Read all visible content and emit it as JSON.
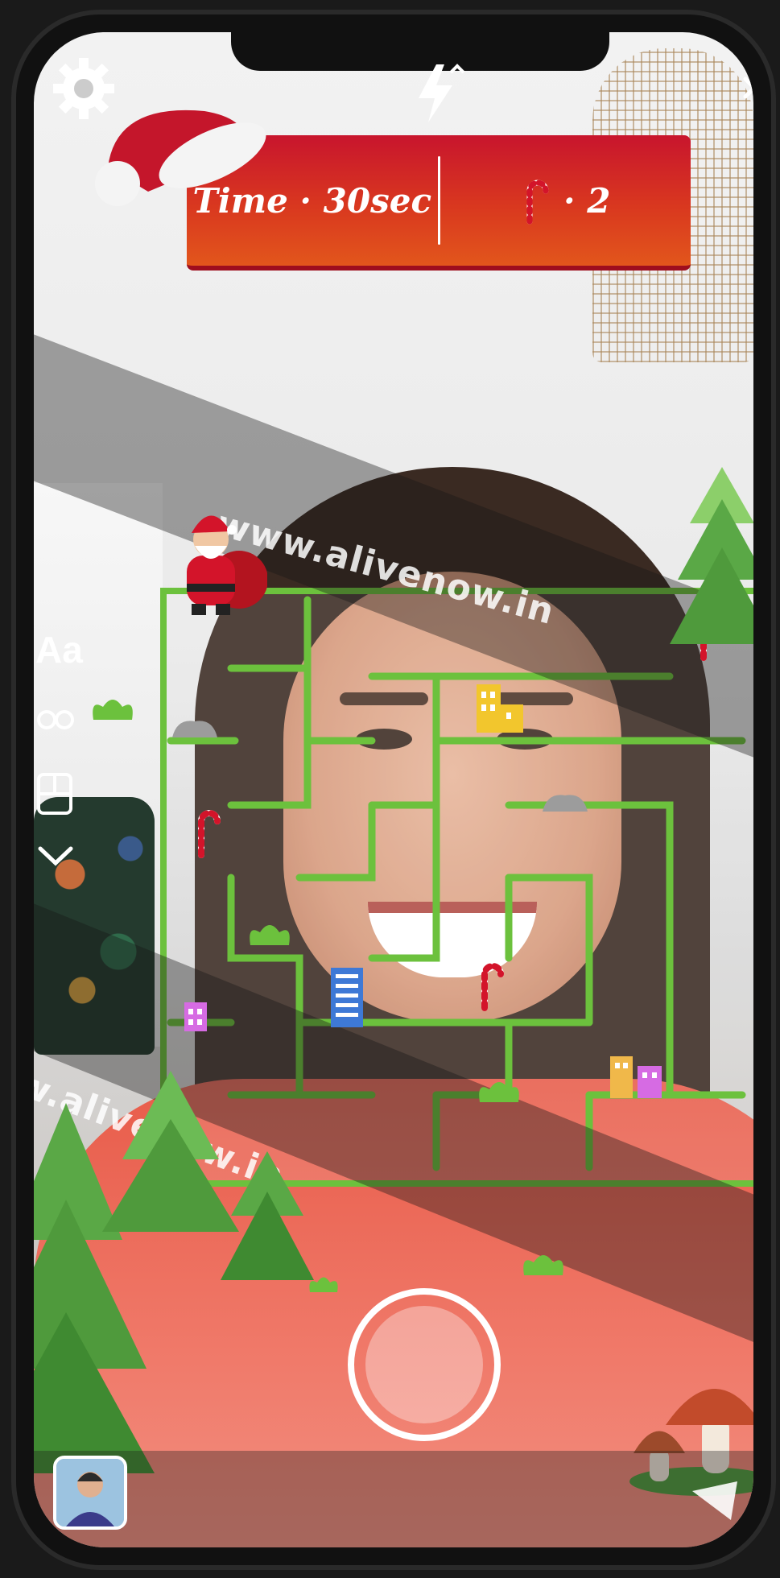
{
  "hud": {
    "time_label": "Time · 30sec",
    "candy_count": "· 2",
    "candy_icon": "candy-cane-icon"
  },
  "watermark": {
    "text_1": "www.alivenow.in",
    "text_2": "w.alivenow.in"
  },
  "side_tools": {
    "text_tool": "Aa"
  },
  "icons": {
    "settings": "gear-icon",
    "flash": "flash-icon",
    "close": "close-icon",
    "capture": "capture-button",
    "avatar": "profile-avatar"
  },
  "colors": {
    "hud_top": "#c8152d",
    "hud_bottom": "#e2561c",
    "maze_wall": "#6cc13d",
    "tree_green": "#4f9a3c"
  }
}
